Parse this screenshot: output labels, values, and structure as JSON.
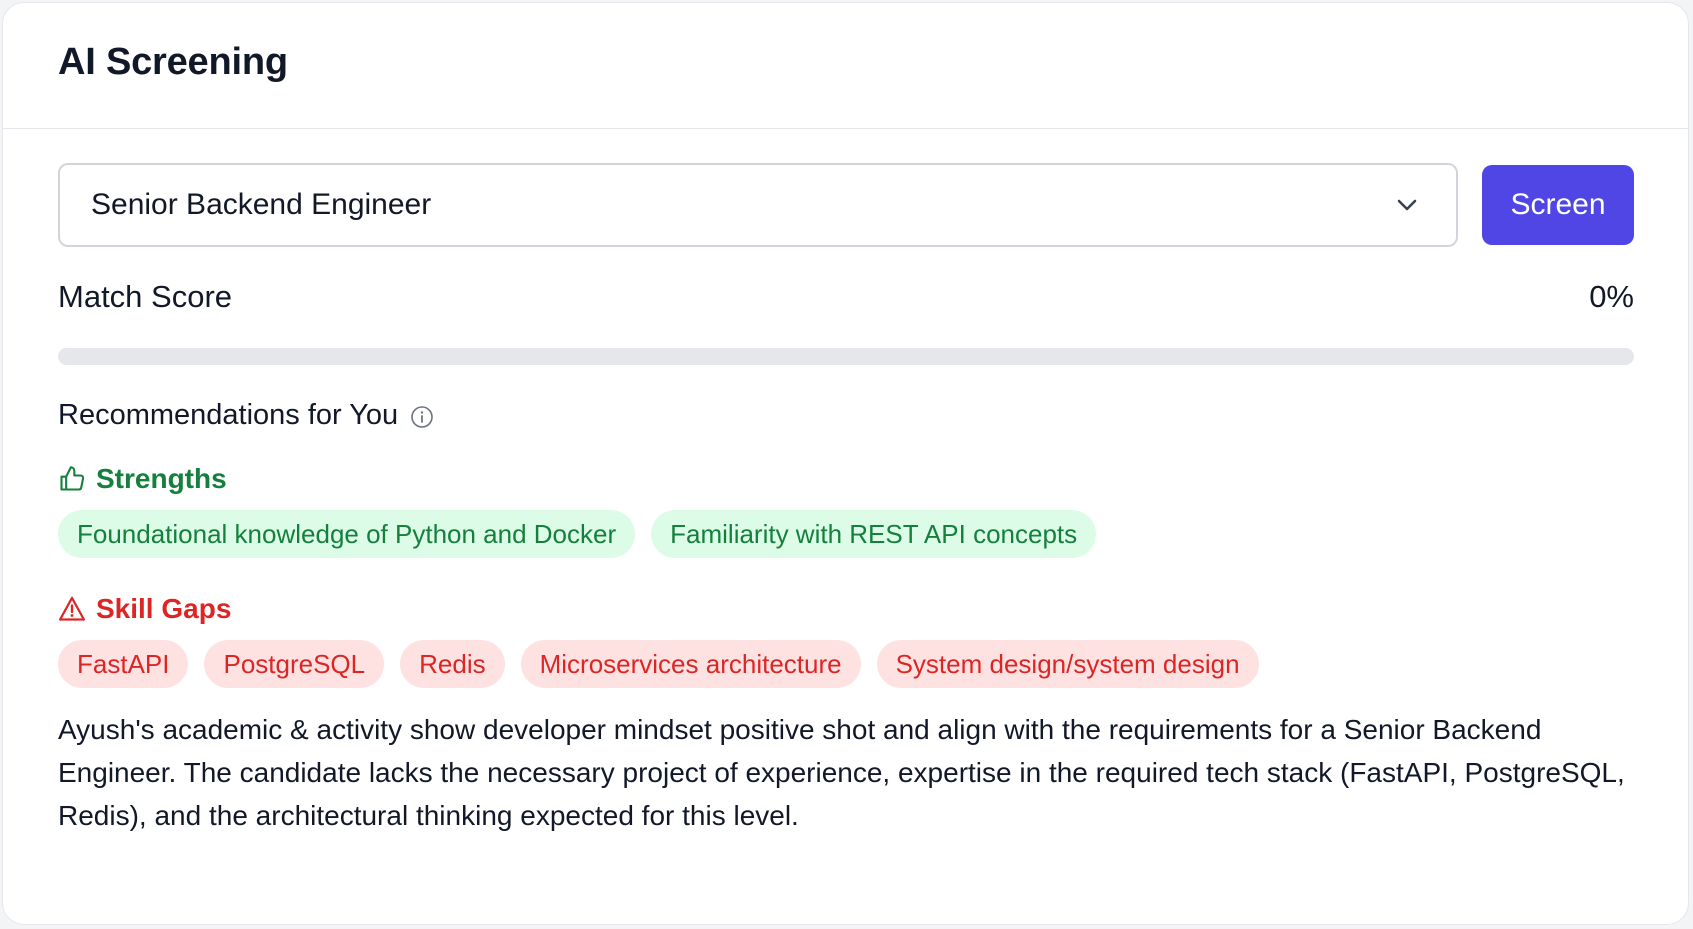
{
  "card": {
    "title": "AI Screening"
  },
  "job_select": {
    "selected_value": "Senior Backend Engineer",
    "icon": "chevron-down-icon"
  },
  "screen_button": {
    "label": "Screen",
    "color": "#4f46e5"
  },
  "match_score": {
    "label": "Match Score",
    "value_text": "0%",
    "value": 0
  },
  "recommendations": {
    "title": "Recommendations for You",
    "info_icon": "info-icon"
  },
  "strengths": {
    "title": "Strengths",
    "icon": "thumbs-up-icon",
    "color": "#15803d",
    "items": [
      "Foundational knowledge of Python and Docker",
      "Familiarity with REST API concepts"
    ]
  },
  "skill_gaps": {
    "title": "Skill Gaps",
    "icon": "warning-triangle-icon",
    "color": "#dc2626",
    "items": [
      "FastAPI",
      "PostgreSQL",
      "Redis",
      "Microservices architecture",
      "System design/system design"
    ]
  },
  "summary": {
    "text": "Ayush's academic & activity show developer mindset positive shot and align with the requirements for a Senior Backend Engineer. The candidate lacks the necessary project of experience, expertise in the required tech stack (FastAPI, PostgreSQL, Redis), and the architectural thinking expected for this level."
  }
}
